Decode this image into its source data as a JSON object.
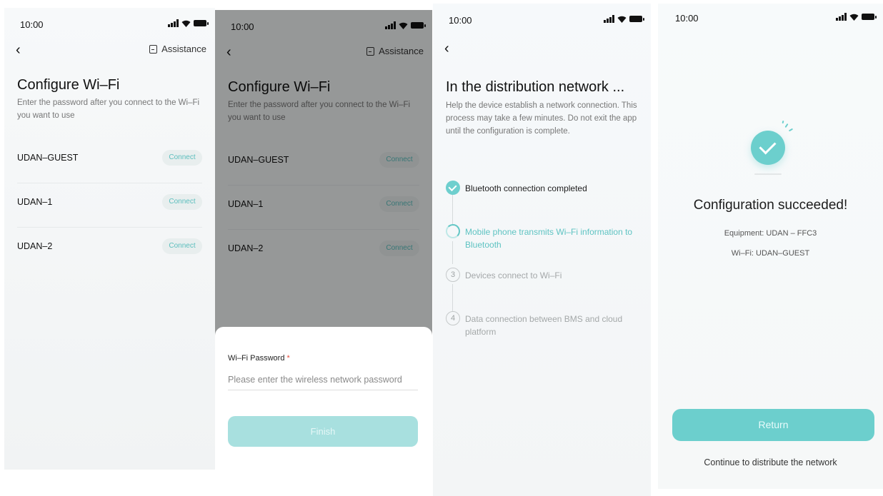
{
  "status_time": "10:00",
  "screen1": {
    "assistance": "Assistance",
    "title": "Configure Wi–Fi",
    "subtitle": "Enter the password after you connect to the Wi–Fi you want to use",
    "networks": [
      {
        "name": "UDAN–GUEST",
        "action": "Connect"
      },
      {
        "name": "UDAN–1",
        "action": "Connect"
      },
      {
        "name": "UDAN–2",
        "action": "Connect"
      }
    ]
  },
  "screen2": {
    "password_label": "Wi–Fi Password",
    "required_mark": "*",
    "password_placeholder": "Please enter the wireless network password",
    "finish_label": "Finish"
  },
  "screen3": {
    "title": "In the distribution network ...",
    "subtitle": "Help the device establish a network connection. This process may take a few minutes. Do not exit the app until the configuration is complete.",
    "steps": [
      {
        "number": "1",
        "state": "done",
        "label": "Bluetooth connection completed"
      },
      {
        "number": "2",
        "state": "in-progress",
        "label": "Mobile phone transmits Wi–Fi information to Bluetooth"
      },
      {
        "number": "3",
        "state": "pending",
        "label": "Devices connect to Wi–Fi"
      },
      {
        "number": "4",
        "state": "pending",
        "label": "Data connection between BMS and cloud platform"
      }
    ]
  },
  "screen4": {
    "success_title": "Configuration succeeded!",
    "equipment_line": "Equipment:  UDAN – FFC3",
    "wifi_line": "Wi–Fi:  UDAN–GUEST",
    "return_label": "Return",
    "continue_label": "Continue to distribute the network"
  },
  "colors": {
    "accent": "#6ccfcd",
    "accent_light": "#a8e0df",
    "required": "#e74c3c"
  }
}
